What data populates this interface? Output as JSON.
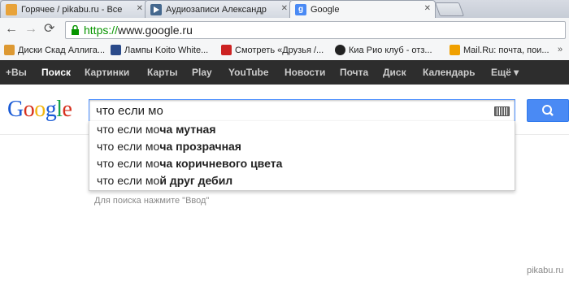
{
  "tabs": [
    {
      "label": "Горячее / pikabu.ru - Все",
      "icon": "pikabu-icon"
    },
    {
      "label": "Аудиозаписи Александр",
      "icon": "vk-icon"
    },
    {
      "label": "Google",
      "icon": "google-icon"
    }
  ],
  "address": {
    "scheme": "https://",
    "host": "www.google.ru"
  },
  "bookmarks": [
    "Диски Скад Аллига...",
    "Лампы Koito White...",
    "Смотреть «Друзья /...",
    "Киа Рио клуб - отз...",
    "Mail.Ru: почта, пои..."
  ],
  "gbar": [
    "+Вы",
    "Поиск",
    "Картинки",
    "Карты",
    "Play",
    "YouTube",
    "Новости",
    "Почта",
    "Диск",
    "Календарь",
    "Ещё ▾"
  ],
  "logo": "Google",
  "search": {
    "query": "что если мо"
  },
  "suggestions": [
    {
      "prefix": "что если мо",
      "rest": "ча мутная"
    },
    {
      "prefix": "что если мо",
      "rest": "ча прозрачная"
    },
    {
      "prefix": "что если мо",
      "rest": "ча коричневого цвета"
    },
    {
      "prefix": "что если мо",
      "rest": "й друг дебил"
    }
  ],
  "hint": "Для поиска нажмите \"Ввод\"",
  "watermark": "pikabu.ru"
}
